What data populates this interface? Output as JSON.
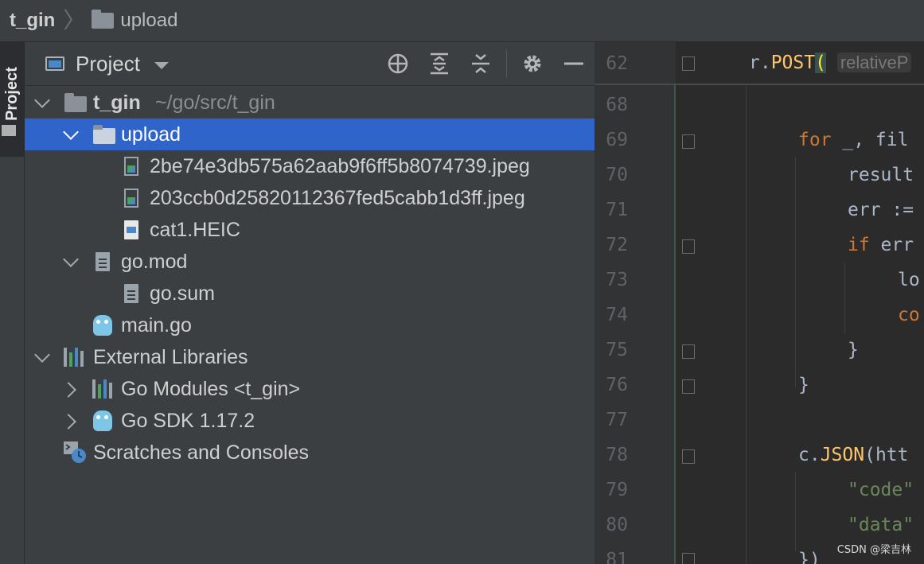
{
  "breadcrumb": {
    "root": "t_gin",
    "folder": "upload"
  },
  "toolstrip": {
    "label": "Project"
  },
  "panel": {
    "title": "Project"
  },
  "tree": {
    "root": {
      "name": "t_gin",
      "path": "~/go/src/t_gin"
    },
    "upload": "upload",
    "file1": "2be74e3db575a62aab9f6ff5b8074739.jpeg",
    "file2": "203ccb0d25820112367fed5cabb1d3ff.jpeg",
    "file3": "cat1.HEIC",
    "gomod": "go.mod",
    "gosum": "go.sum",
    "maingo": "main.go",
    "extlibs": "External Libraries",
    "gomodules": "Go Modules <t_gin>",
    "gosdk": "Go SDK 1.17.2",
    "scratches": "Scratches and Consoles"
  },
  "editor": {
    "sticky": {
      "line": "62",
      "prefix": "r.",
      "fn": "POST",
      "paren": "(",
      "hint": "relativeP"
    },
    "lines": [
      {
        "n": "68",
        "pre": "",
        "kw": "",
        "rest": ""
      },
      {
        "n": "69",
        "pre": "",
        "kw": "for",
        "rest": " _, fil"
      },
      {
        "n": "70",
        "pre": "",
        "kw": "",
        "rest": "result"
      },
      {
        "n": "71",
        "pre": "",
        "kw": "",
        "rest": "err :="
      },
      {
        "n": "72",
        "pre": "",
        "kw": "if",
        "rest": " err"
      },
      {
        "n": "73",
        "pre": "",
        "kw": "",
        "rest": "lo"
      },
      {
        "n": "74",
        "pre": "",
        "kw": "co",
        "rest": ""
      },
      {
        "n": "75",
        "pre": "",
        "kw": "",
        "rest": "}"
      },
      {
        "n": "76",
        "pre": "",
        "kw": "",
        "rest": "}"
      },
      {
        "n": "77",
        "pre": "",
        "kw": "",
        "rest": ""
      },
      {
        "n": "78",
        "pre": "c.",
        "kw": "JSON",
        "rest": "(htt"
      },
      {
        "n": "79",
        "pre": "",
        "kw": "",
        "rest": "\"code\""
      },
      {
        "n": "80",
        "pre": "",
        "kw": "",
        "rest": "\"data\""
      },
      {
        "n": "81",
        "pre": "",
        "kw": "",
        "rest": "})"
      }
    ]
  },
  "watermark": "CSDN @梁吉林",
  "colors": {
    "selection": "#2f65ca",
    "keyword": "#cc7832",
    "string": "#6a8759",
    "function": "#ffc66d"
  }
}
